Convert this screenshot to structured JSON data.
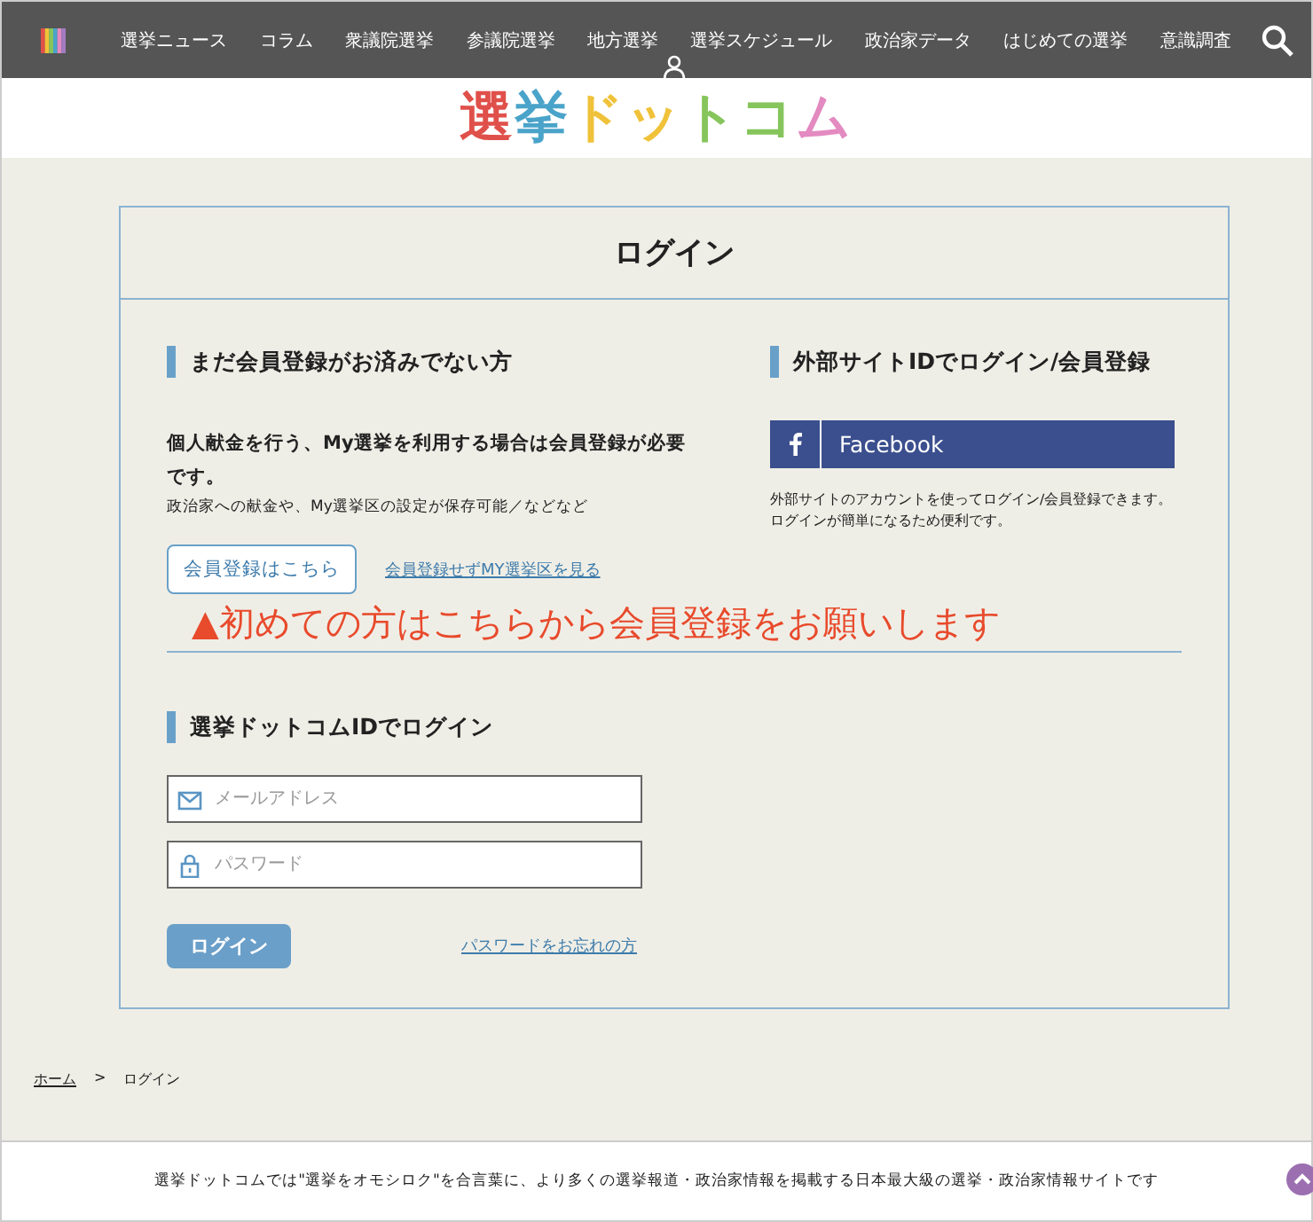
{
  "nav": {
    "items": [
      "選挙ニュース",
      "コラム",
      "衆議院選挙",
      "参議院選挙",
      "地方選挙",
      "選挙スケジュール",
      "政治家データ",
      "はじめての選挙",
      "意識調査"
    ]
  },
  "logo": {
    "text": "選挙ドットコム"
  },
  "card": {
    "title": "ログイン",
    "register": {
      "heading": "まだ会員登録がお済みでない方",
      "lead": "個人献金を行う、My選挙を利用する場合は会員登録が必要です。",
      "note": "政治家への献金や、My選挙区の設定が保存可能／などなど",
      "button": "会員登録はこちら",
      "link": "会員登録せずMY選挙区を見る"
    },
    "external": {
      "heading": "外部サイトIDでログイン/会員登録",
      "facebook": "Facebook",
      "note": [
        "外部サイトのアカウントを使ってログイン/会員登録できます。",
        "ログインが簡単になるため便利です。"
      ]
    },
    "annotation": "▲初めての方はこちらから会員登録をお願いします",
    "login": {
      "heading": "選挙ドットコムIDでログイン",
      "email": {
        "placeholder": "メールアドレス"
      },
      "password": {
        "placeholder": "パスワード"
      },
      "button": "ログイン",
      "forgot": "パスワードをお忘れの方"
    }
  },
  "breadcrumb": [
    {
      "label": "ホーム",
      "link": true
    },
    {
      "label": ">",
      "link": false
    },
    {
      "label": "ログイン",
      "link": false
    }
  ],
  "footer": {
    "text": "選挙ドットコムでは\"選挙をオモシロク\"を合言葉に、より多くの選挙報道・政治家情報を掲載する日本最大級の選挙・政治家情報サイトです"
  }
}
